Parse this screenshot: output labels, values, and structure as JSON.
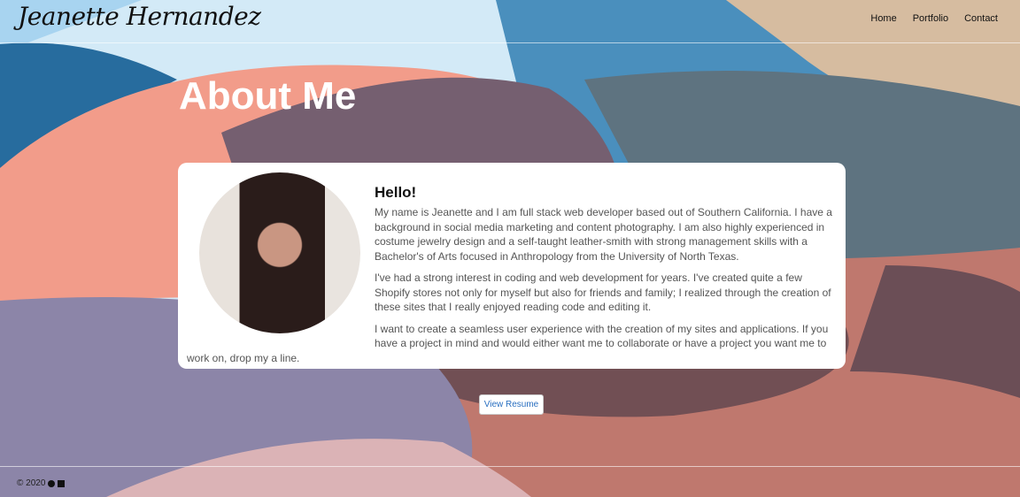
{
  "header": {
    "logo": "Jeanette Hernandez",
    "nav": [
      "Home",
      "Portfolio",
      "Contact"
    ]
  },
  "main": {
    "title": "About Me",
    "card": {
      "greeting": "Hello!",
      "paragraphs": [
        "My name is Jeanette and I am full stack web developer based out of Southern California. I have a background in social media marketing and content photography. I am also highly experienced in costume jewelry design and a self-taught leather-smith with strong management skills with a Bachelor's of Arts focused in Anthropology from the University of North Texas.",
        "I've had a strong interest in coding and web development for years. I've created quite a few Shopify stores not only for myself but also for friends and family; I realized through the creation of these sites that I really enjoyed reading code and editing it.",
        "I want to create a seamless user experience with the creation of my sites and applications. If you have a project in mind and would either want me to collaborate or have a project you want me to work on, drop my a line."
      ]
    },
    "resume_button": "View Resume"
  },
  "footer": {
    "copyright": "© 2020",
    "icons": [
      "github-icon",
      "linkedin-icon"
    ]
  },
  "colors": {
    "accent": "#2a6fc0"
  }
}
